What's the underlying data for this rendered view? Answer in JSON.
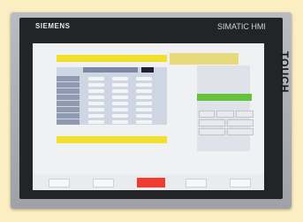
{
  "device": {
    "brand": "SIEMENS",
    "model": "SIMATIC HMI",
    "touch": "TOUCH"
  },
  "screen": {
    "header_title": "",
    "status_text": "",
    "accent_label": "",
    "table": {
      "tab_label": "",
      "rows": [
        {
          "label": ""
        },
        {
          "label": ""
        },
        {
          "label": ""
        },
        {
          "label": ""
        },
        {
          "label": ""
        },
        {
          "label": ""
        },
        {
          "label": ""
        },
        {
          "label": ""
        }
      ]
    },
    "yellow_bar_text": "",
    "bottom_label": "",
    "footer": {
      "button_1": "",
      "button_2": "",
      "button_3": "",
      "button_4": "",
      "red_button": ""
    },
    "colors": {
      "yellow": "#f2df2e",
      "green": "#63c43b",
      "red": "#f03b31",
      "blue_gray": "#8f9ab1"
    }
  }
}
